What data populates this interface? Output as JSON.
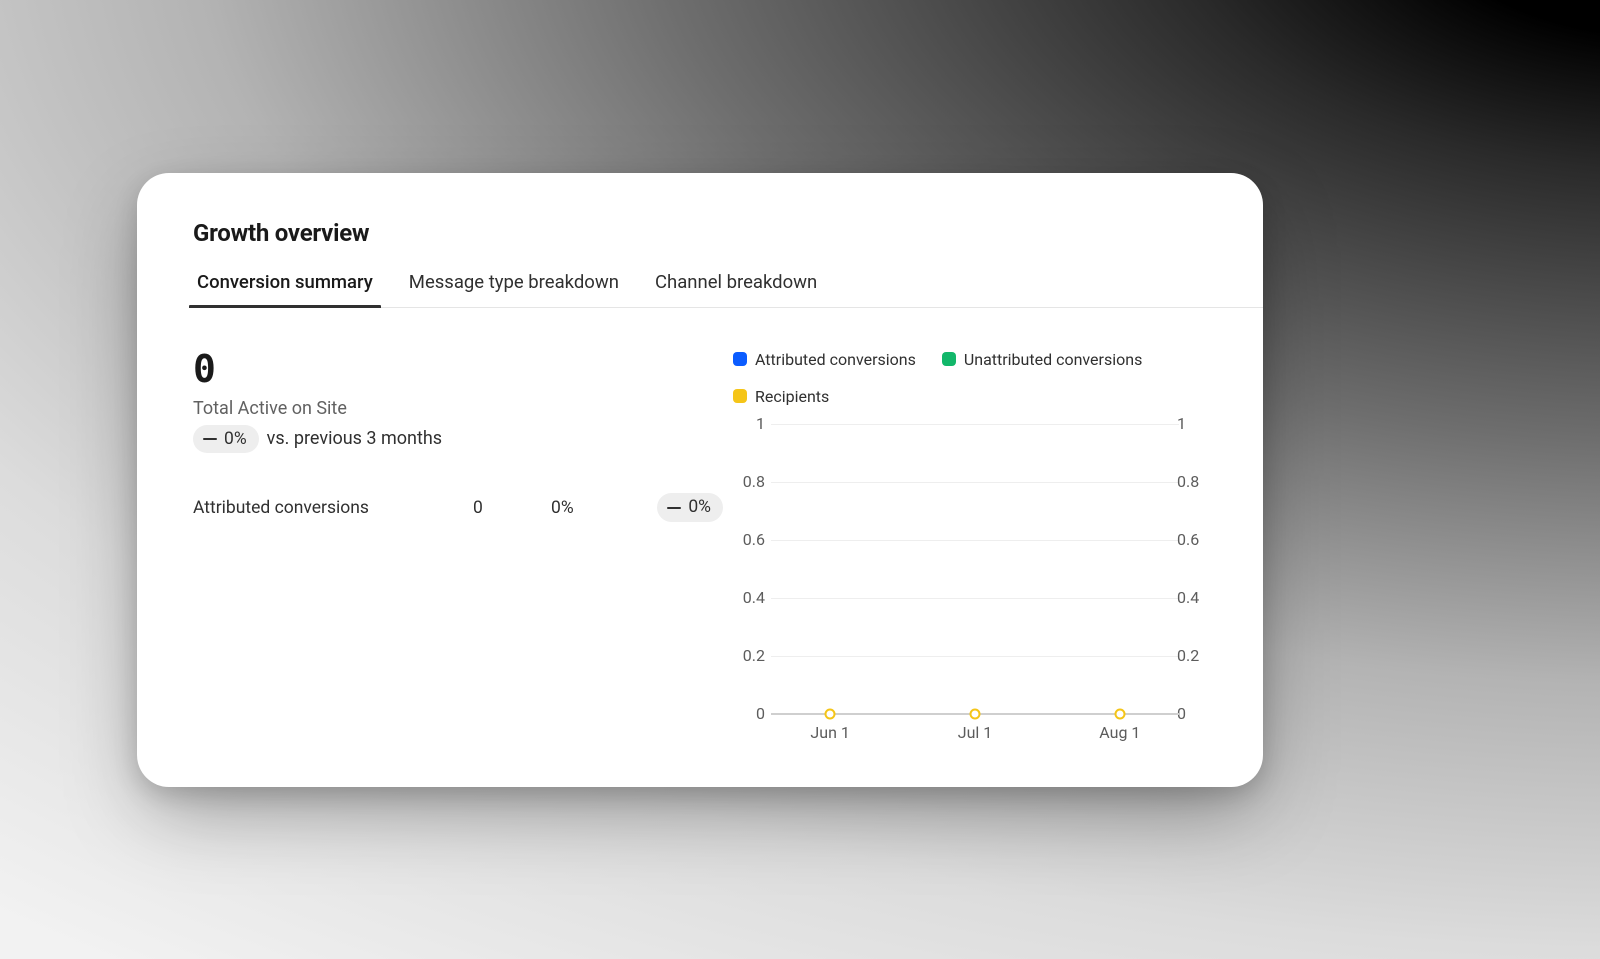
{
  "title": "Growth overview",
  "tabs": [
    {
      "id": "conversion-summary",
      "label": "Conversion summary",
      "active": true
    },
    {
      "id": "message-type-breakdown",
      "label": "Message type breakdown",
      "active": false
    },
    {
      "id": "channel-breakdown",
      "label": "Channel breakdown",
      "active": false
    }
  ],
  "primary_metric": {
    "value": "0",
    "label": "Total Active on Site",
    "delta": "0%",
    "compare_text": "vs. previous 3 months"
  },
  "rows": [
    {
      "label": "Attributed conversions",
      "value": "0",
      "percent": "0%",
      "delta": "0%"
    }
  ],
  "legend_colors": {
    "attributed": "#0b5cff",
    "unattributed": "#12b76a",
    "recipients": "#f5c518"
  },
  "legend_labels": {
    "attributed": "Attributed conversions",
    "unattributed": "Unattributed conversions",
    "recipients": "Recipients"
  },
  "chart_data": {
    "type": "line",
    "x": [
      "Jun 1",
      "Jul 1",
      "Aug 1"
    ],
    "ylim_left": [
      0,
      1
    ],
    "ylim_right": [
      0,
      1
    ],
    "yticks": [
      "0",
      "0.2",
      "0.4",
      "0.6",
      "0.8",
      "1"
    ],
    "series": [
      {
        "name": "Attributed conversions",
        "color": "#0b5cff",
        "values": [
          0,
          0,
          0
        ]
      },
      {
        "name": "Unattributed conversions",
        "color": "#12b76a",
        "values": [
          0,
          0,
          0
        ]
      },
      {
        "name": "Recipients",
        "color": "#f5c518",
        "values": [
          0,
          0,
          0
        ]
      }
    ]
  }
}
